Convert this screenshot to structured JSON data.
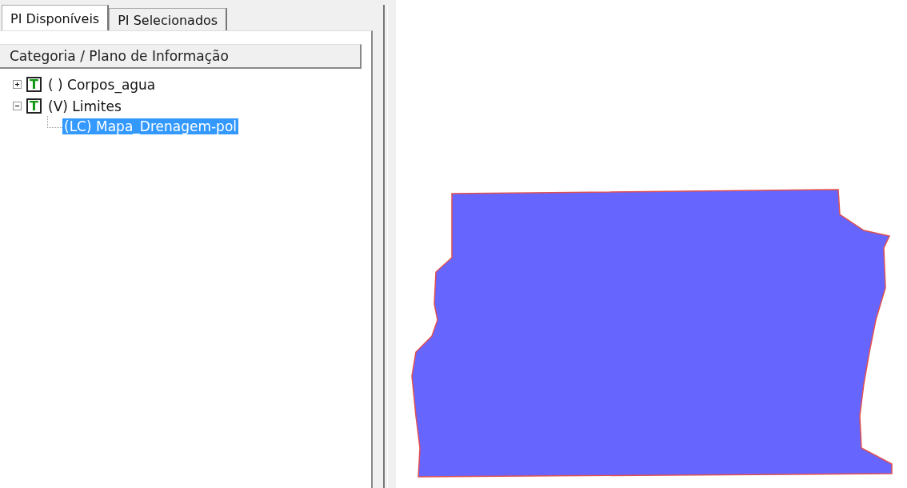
{
  "tabs": [
    {
      "label": "PI Disponíveis",
      "selected": true
    },
    {
      "label": "PI Selecionados",
      "selected": false
    }
  ],
  "tree": {
    "header": "Categoria / Plano de Informação",
    "items": [
      {
        "badge": "T",
        "label": "( ) Corpos_agua",
        "expanded": false,
        "selected": false
      },
      {
        "badge": "T",
        "label": "(V) Limites",
        "expanded": true,
        "selected": false,
        "children": [
          {
            "label": "(LC) Mapa_Drenagem-pol",
            "selected": true
          }
        ]
      }
    ]
  },
  "map": {
    "kind": "polygon"
  }
}
